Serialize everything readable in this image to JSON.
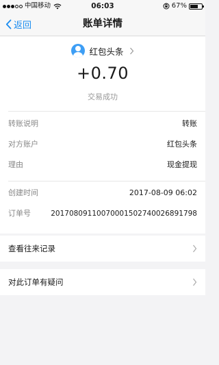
{
  "status_bar": {
    "carrier": "中国移动",
    "time": "06:03",
    "battery": "67%",
    "battery_level": 0.67
  },
  "nav": {
    "back_label": "返回",
    "title": "账单详情"
  },
  "transaction": {
    "payee": "红包头条",
    "amount": "+0.70",
    "status": "交易成功"
  },
  "details": [
    {
      "key": "转账说明",
      "value": "转账"
    },
    {
      "key": "对方账户",
      "value": "红包头条"
    },
    {
      "key": "理由",
      "value": "现金提现"
    }
  ],
  "meta": [
    {
      "key": "创建时间",
      "value": "2017-08-09 06:02"
    },
    {
      "key": "订单号",
      "value": "20170809110070001502740026891798"
    }
  ],
  "actions": {
    "history": "查看往来记录",
    "question": "对此订单有疑问"
  },
  "colors": {
    "accent": "#1a8cf0",
    "avatar": "#3d9ef5"
  }
}
